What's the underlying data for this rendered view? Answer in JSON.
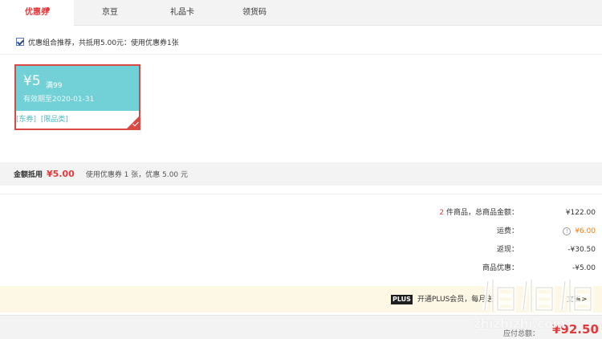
{
  "tabs": [
    {
      "label": "优惠券",
      "active": true,
      "has_dot": true
    },
    {
      "label": "京豆",
      "active": false
    },
    {
      "label": "礼品卡",
      "active": false
    },
    {
      "label": "领货码",
      "active": false
    }
  ],
  "recommendation": {
    "checked": true,
    "text": "优惠组合推荐，共抵用5.00元：使用优惠券1张"
  },
  "coupon": {
    "amount": "¥5",
    "condition": "满99",
    "validity": "有效期至2020-01-31",
    "tags": [
      "[东券]",
      "[限品类]"
    ],
    "selected": true
  },
  "summary": {
    "label": "金额抵用",
    "amount": "¥5.00",
    "description": "使用优惠券 1 张，优惠 5.00 元"
  },
  "totals": {
    "item_count": "2",
    "items_label": " 件商品，总商品金额：",
    "items_total": "¥122.00",
    "shipping_label": "运费：",
    "shipping_value": "¥6.00",
    "cashback_label": "返现：",
    "cashback_value": "-¥30.50",
    "discount_label": "商品优惠：",
    "discount_value": "-¥5.00"
  },
  "plus": {
    "badge": "PLUS",
    "text": "开通PLUS会员，每月送",
    "link": "立省>"
  },
  "payment": {
    "label": "应付总额：",
    "amount": "¥92.50"
  },
  "watermark": {
    "url": "zhizhizhi.com"
  },
  "colors": {
    "accent_red": "#e4393c",
    "coupon_teal": "#72d1d7",
    "shipping_orange": "#ff7800",
    "plus_bar": "#fdf8e6"
  }
}
